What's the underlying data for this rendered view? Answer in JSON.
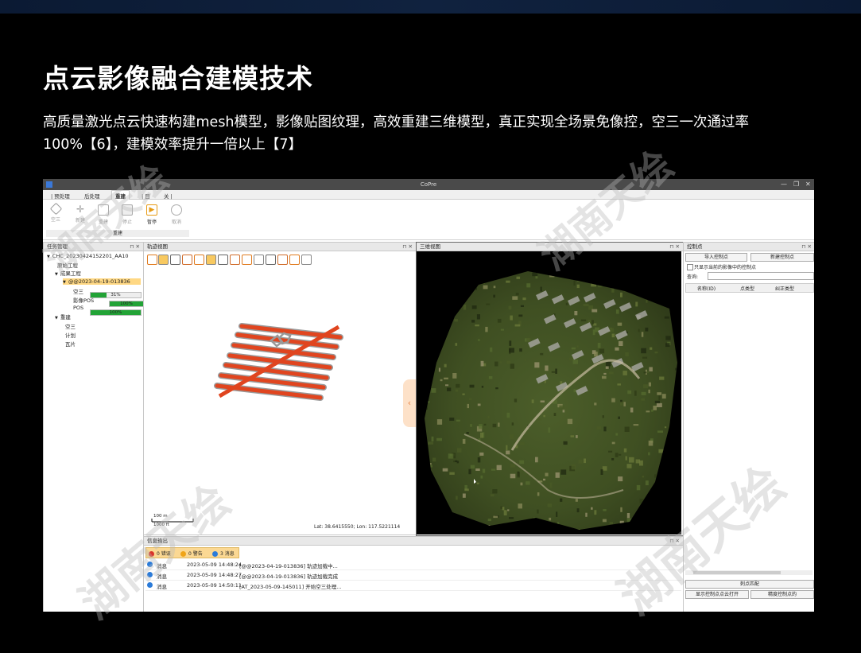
{
  "slide": {
    "title": "点云影像融合建模技术",
    "subtitle": "高质量激光点云快速构建mesh模型，影像贴图纹理，高效重建三维模型，真正实现全场景免像控，空三一次通过率100%【6】，建模效率提升一倍以上【7】"
  },
  "watermarks": [
    "湖南天绘",
    "湖南天绘",
    "湖南天绘",
    "湖南天绘"
  ],
  "app": {
    "title": "CoPre",
    "window_buttons": [
      "—",
      "❐",
      "✕"
    ],
    "ribbon_tabs": [
      "| 预处理",
      "后处理",
      "重建",
      "| 目",
      "关 |"
    ],
    "active_tab_index": 2,
    "ribbon_buttons": [
      "空三",
      "新建",
      "重建",
      "停止",
      "暂停",
      "取消"
    ],
    "ribbon_group": "重建"
  },
  "task_panel": {
    "title": "任务管理",
    "tree": [
      {
        "label": "CHC_20230424152201_AA10",
        "indent": 0,
        "arrow": "▼"
      },
      {
        "label": "原始工程",
        "indent": 1,
        "arrow": ""
      },
      {
        "label": "成果工程",
        "indent": 1,
        "arrow": "▼"
      },
      {
        "label": "@@2023-04-19-013836",
        "indent": 2,
        "arrow": "▼",
        "selected": true
      },
      {
        "label": "空三",
        "indent": 3,
        "arrow": ""
      },
      {
        "label": "影像POS",
        "indent": 3,
        "arrow": ""
      },
      {
        "label": "POS",
        "indent": 3,
        "arrow": ""
      },
      {
        "label": "重建",
        "indent": 1,
        "arrow": "▼"
      },
      {
        "label": "空三",
        "indent": 2,
        "arrow": ""
      },
      {
        "label": "计划",
        "indent": 2,
        "arrow": ""
      },
      {
        "label": "瓦片",
        "indent": 2,
        "arrow": ""
      }
    ],
    "progress": [
      {
        "label": "31%",
        "value": 0.31
      },
      {
        "label": "100%",
        "value": 1.0
      },
      {
        "label": "100%",
        "value": 1.0
      }
    ]
  },
  "track_panel": {
    "title": "轨迹视图",
    "scale_top": "100 m",
    "scale_bottom": "1000 ft",
    "coords": "Lat: 38.6415550; Lon: 117.5221114"
  },
  "view3d": {
    "title": "三维视图"
  },
  "control_panel": {
    "title": "控制点",
    "import_button": "导入控制点",
    "new_button": "新建控制点",
    "checkbox_label": "只显示当前的影像中的控制点",
    "search_label": "查询:",
    "search_value": "",
    "columns": [
      "名称(ID)",
      "点类型",
      "纠正类型"
    ],
    "bottom_buttons": [
      "刺点匹配",
      "显示控制点点云打开",
      "精度控制点的"
    ]
  },
  "info_panel": {
    "title": "信息输出",
    "filters": [
      {
        "label": "0 错误",
        "color": "#d9342b"
      },
      {
        "label": "0 警告",
        "color": "#f0a418"
      },
      {
        "label": "3 消息",
        "color": "#2b7bd9"
      }
    ],
    "rows": [
      {
        "type": "消息",
        "time": "2023-05-09 14:48:24",
        "msg": "[@@2023-04-19-013836] 轨迹加载中..."
      },
      {
        "type": "消息",
        "time": "2023-05-09 14:48:27",
        "msg": "[@@2023-04-19-013836] 轨迹加载完成"
      },
      {
        "type": "消息",
        "time": "2023-05-09 14:50:11",
        "msg": "[AT_2023-05-09-145011] 开始空三处理..."
      }
    ]
  },
  "colors": {
    "accent": "#f5a623",
    "progress": "#22a336",
    "track": "#e0451f",
    "selected": "#ffd884"
  }
}
